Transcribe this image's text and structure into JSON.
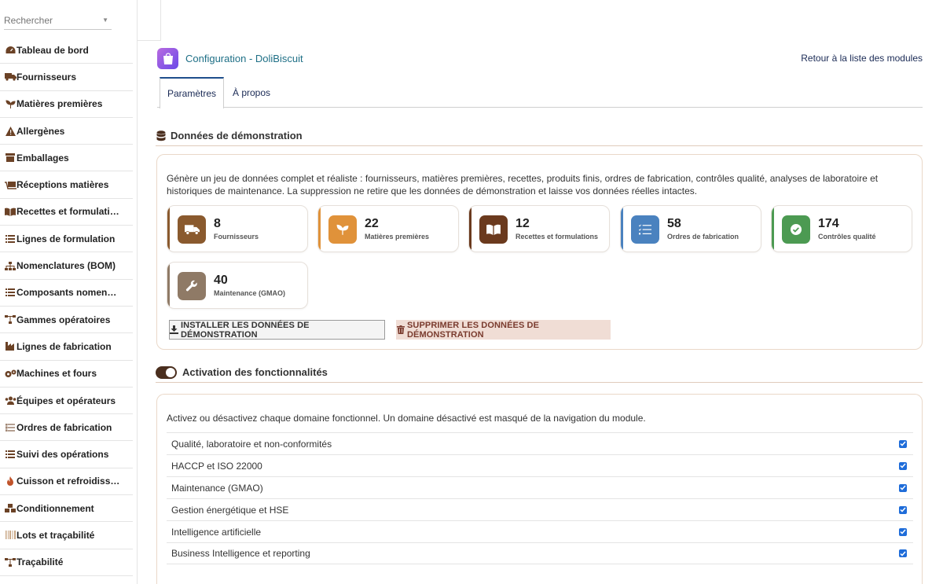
{
  "sidebar": {
    "search_placeholder": "Rechercher",
    "items": [
      {
        "label": "Tableau de bord",
        "icon": "dashboard-icon"
      },
      {
        "label": "Fournisseurs",
        "icon": "truck-icon"
      },
      {
        "label": "Matières premières",
        "icon": "seedling-icon"
      },
      {
        "label": "Allergènes",
        "icon": "warning-icon"
      },
      {
        "label": "Emballages",
        "icon": "box-icon"
      },
      {
        "label": "Réceptions matières",
        "icon": "dolly-icon"
      },
      {
        "label": "Recettes et formulati…",
        "icon": "book-icon"
      },
      {
        "label": "Lignes de formulation",
        "icon": "list-icon"
      },
      {
        "label": "Nomenclatures (BOM)",
        "icon": "sitemap-icon"
      },
      {
        "label": "Composants nomen…",
        "icon": "list-icon"
      },
      {
        "label": "Gammes opératoires",
        "icon": "flow-icon"
      },
      {
        "label": "Lignes de fabrication",
        "icon": "industry-icon"
      },
      {
        "label": "Machines et fours",
        "icon": "cogs-icon"
      },
      {
        "label": "Équipes et opérateurs",
        "icon": "users-icon"
      },
      {
        "label": "Ordres de fabrication",
        "icon": "tasks-icon"
      },
      {
        "label": "Suivi des opérations",
        "icon": "list-icon"
      },
      {
        "label": "Cuisson et refroidiss…",
        "icon": "fire-icon"
      },
      {
        "label": "Conditionnement",
        "icon": "boxes-icon"
      },
      {
        "label": "Lots et traçabilité",
        "icon": "barcode-icon"
      },
      {
        "label": "Traçabilité",
        "icon": "flow-icon"
      }
    ]
  },
  "header": {
    "title": "Configuration - DoliBiscuit",
    "back_link": "Retour à la liste des modules"
  },
  "tabs": [
    {
      "label": "Paramètres",
      "active": true
    },
    {
      "label": "À propos",
      "active": false
    }
  ],
  "demo": {
    "title": "Données de démonstration",
    "description": "Génère un jeu de données complet et réaliste : fournisseurs, matières premières, recettes, produits finis, ordres de fabrication, contrôles qualité, analyses de laboratoire et historiques de maintenance. La suppression ne retire que les données de démonstration et laisse vos données réelles intactes.",
    "stats": [
      {
        "value": "8",
        "label": "Fournisseurs",
        "icon": "truck-icon",
        "color": "#8a5a2e"
      },
      {
        "value": "22",
        "label": "Matières premières",
        "icon": "seedling-icon",
        "color": "#e0923a"
      },
      {
        "value": "12",
        "label": "Recettes et formulations",
        "icon": "book-icon",
        "color": "#6b3a1e"
      },
      {
        "value": "58",
        "label": "Ordres de fabrication",
        "icon": "tasks-icon",
        "color": "#4a82bf"
      },
      {
        "value": "174",
        "label": "Contrôles qualité",
        "icon": "check-circle-icon",
        "color": "#4c9a52"
      },
      {
        "value": "40",
        "label": "Maintenance (GMAO)",
        "icon": "wrench-icon",
        "color": "#8f7a66"
      }
    ],
    "install_label": "INSTALLER LES DONNÉES DE DÉMONSTRATION",
    "delete_label": "SUPPRIMER LES DONNÉES DE DÉMONSTRATION"
  },
  "features": {
    "title": "Activation des fonctionnalités",
    "description": "Activez ou désactivez chaque domaine fonctionnel. Un domaine désactivé est masqué de la navigation du module.",
    "items": [
      {
        "label": "Qualité, laboratoire et non-conformités",
        "checked": true
      },
      {
        "label": "HACCP et ISO 22000",
        "checked": true
      },
      {
        "label": "Maintenance (GMAO)",
        "checked": true
      },
      {
        "label": "Gestion énergétique et HSE",
        "checked": true
      },
      {
        "label": "Intelligence artificielle",
        "checked": true
      },
      {
        "label": "Business Intelligence et reporting",
        "checked": true
      }
    ]
  }
}
